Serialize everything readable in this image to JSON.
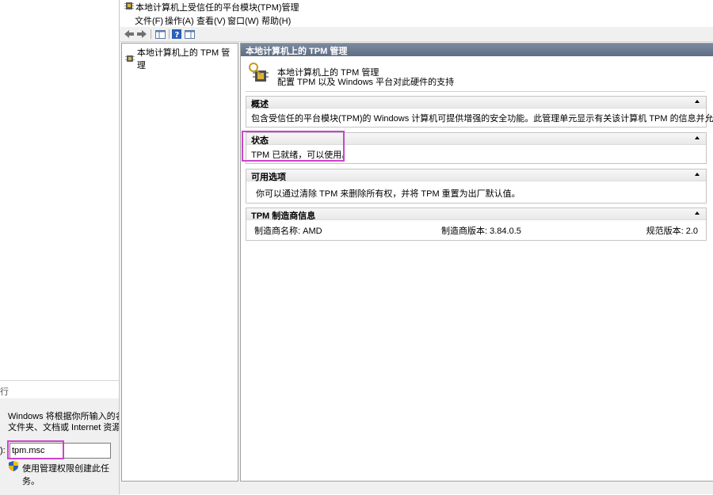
{
  "run_dialog": {
    "title_fragment": "行",
    "description": "Windows 将根据你所输入的名称，为\n文件夹、文档或 Internet 资源。",
    "open_label": "):",
    "open_value": "tpm.msc",
    "admin_note": "使用管理权限创建此任务。"
  },
  "window": {
    "title": "本地计算机上受信任的平台模块(TPM)管理",
    "menu": [
      "文件(F)",
      "操作(A)",
      "查看(V)",
      "窗口(W)",
      "帮助(H)"
    ]
  },
  "tree": {
    "root_label": "本地计算机上的 TPM 管理"
  },
  "content": {
    "header": "本地计算机上的 TPM 管理",
    "banner_title": "本地计算机上的 TPM 管理",
    "banner_subtitle": "配置 TPM 以及 Windows 平台对此硬件的支持",
    "sections": {
      "overview": {
        "title": "概述",
        "body": "包含受信任的平台模块(TPM)的 Windows 计算机可提供增强的安全功能。此管理单元显示有关该计算机 TPM 的信息并允许管理员管理此设备。"
      },
      "status": {
        "title": "状态",
        "body": "TPM 已就绪，可以使用。"
      },
      "options": {
        "title": "可用选项",
        "body": "你可以通过清除 TPM 来删除所有权，并将 TPM 重置为出厂默认值。"
      },
      "manufacturer": {
        "title": "TPM 制造商信息",
        "name_label": "制造商名称: AMD",
        "version_label": "制造商版本: 3.84.0.5",
        "spec_label": "规范版本: 2.0"
      }
    }
  },
  "colors": {
    "highlight": "#cc44cc",
    "header_bg": "#5e6d83"
  }
}
